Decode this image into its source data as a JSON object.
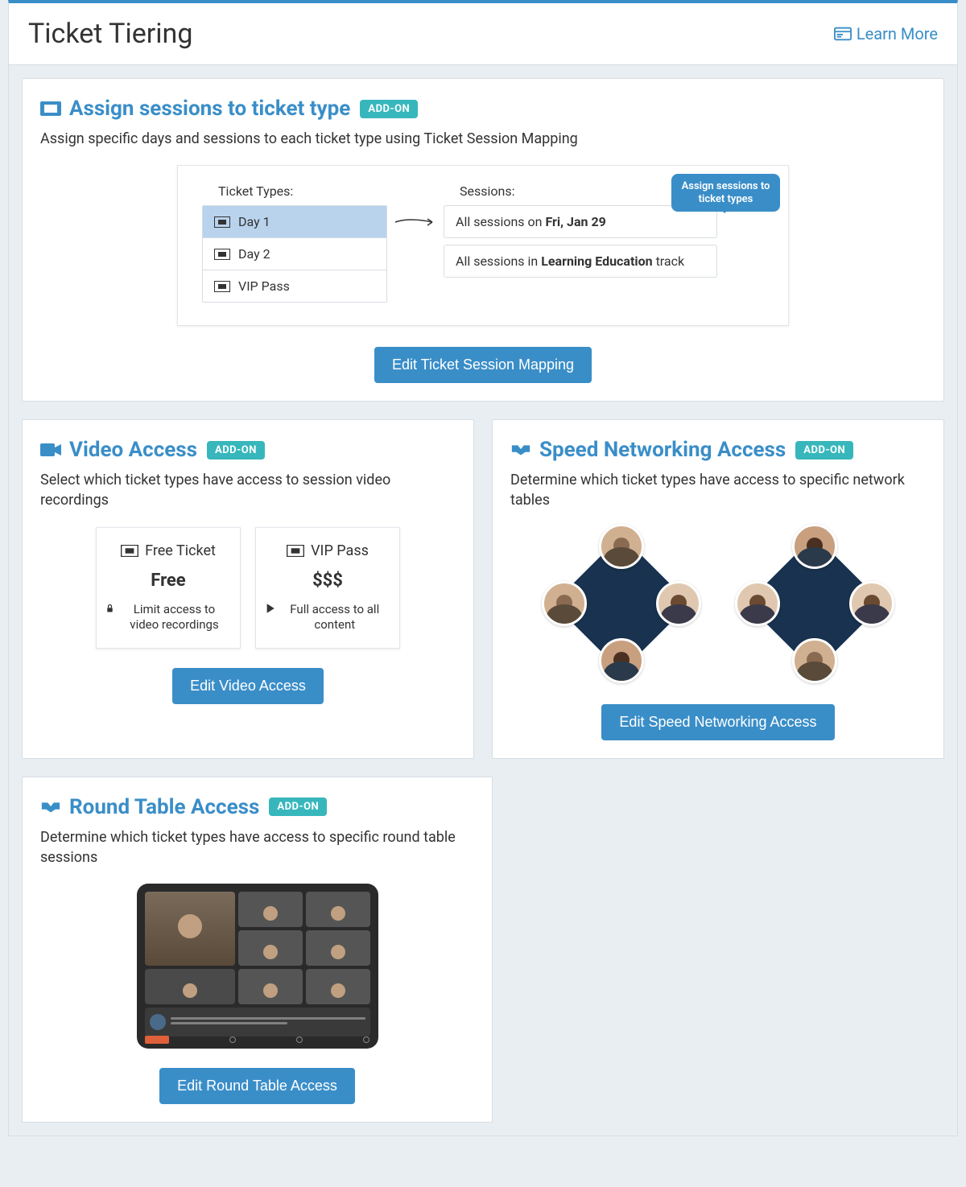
{
  "header": {
    "title": "Ticket Tiering",
    "learn_more": "Learn More"
  },
  "addon_label": "ADD-ON",
  "sessions_card": {
    "title": "Assign sessions to ticket type",
    "desc": "Assign specific days and sessions to each ticket type using Ticket Session Mapping",
    "button": "Edit Ticket Session Mapping",
    "illus": {
      "ticket_types_label": "Ticket Types:",
      "sessions_label": "Sessions:",
      "bubble": "Assign sessions to ticket types",
      "ticket_types": [
        "Day 1",
        "Day 2",
        "VIP Pass"
      ],
      "session1_prefix": "All sessions on ",
      "session1_bold": "Fri, Jan 29",
      "session2_prefix": "All sessions in ",
      "session2_bold": "Learning Education",
      "session2_suffix": " track"
    }
  },
  "video_card": {
    "title": "Video Access",
    "desc": "Select which ticket types have access to session video recordings",
    "button": "Edit Video Access",
    "tickets": [
      {
        "name": "Free Ticket",
        "price": "Free",
        "note": "Limit access to video recordings"
      },
      {
        "name": "VIP Pass",
        "price": "$$$",
        "note": "Full access to all content"
      }
    ]
  },
  "speed_card": {
    "title": "Speed Networking Access",
    "desc": "Determine which ticket types have access to specific network tables",
    "button": "Edit Speed Networking Access"
  },
  "round_card": {
    "title": "Round Table Access",
    "desc": "Determine which ticket types have access to specific round table sessions",
    "button": "Edit Round Table Access"
  }
}
